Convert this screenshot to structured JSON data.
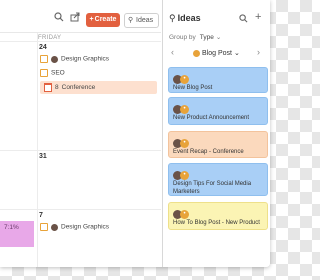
{
  "toolbar": {
    "create_label": "Create",
    "ideas_label": "Ideas",
    "search_icon": "search-icon",
    "share_icon": "share-icon"
  },
  "calendar": {
    "day_header": "FRIDAY",
    "days": [
      {
        "num": "24"
      },
      {
        "num": "31"
      },
      {
        "num": "7"
      }
    ],
    "events": [
      {
        "label": "Design Graphics"
      },
      {
        "label": "SEO"
      },
      {
        "count": "8",
        "label": "Conference"
      },
      {
        "label": "Design Graphics"
      }
    ],
    "side_event_label": "7:1%"
  },
  "panel": {
    "title": "Ideas",
    "group_by_label": "Group by",
    "group_by_value": "Type",
    "nav_label": "Blog Post",
    "cards": [
      {
        "text": "New Blog Post",
        "color": "#a9cff6"
      },
      {
        "text": "New Product Announcement",
        "color": "#a9cff6"
      },
      {
        "text": "Event Recap - Conference",
        "color": "#fbd9bd"
      },
      {
        "text": "Design Tips For Social Media Marketers",
        "color": "#a9cff6"
      },
      {
        "text": "How To Blog Post - New Product",
        "color": "#fbf4b4"
      }
    ]
  },
  "colors": {
    "accent": "#e2603f",
    "blue_card": "#a9cff6",
    "orange_card": "#fbd9bd",
    "yellow_card": "#fbf4b4"
  }
}
